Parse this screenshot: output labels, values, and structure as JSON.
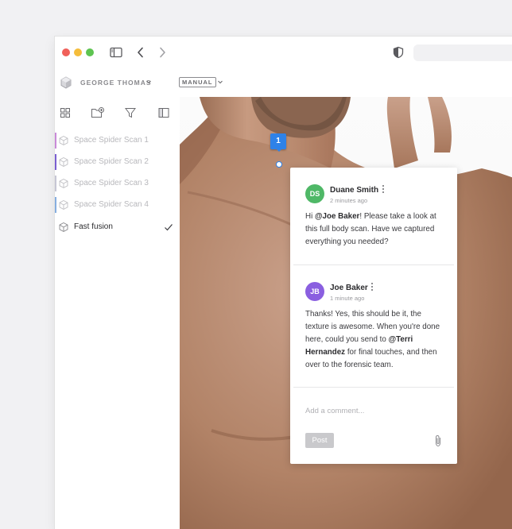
{
  "window": {
    "traffic_lights": [
      "close",
      "minimize",
      "zoom"
    ],
    "toolbar_icons": [
      "sidebar-toggle-icon",
      "back-chevron-icon",
      "forward-chevron-icon",
      "shield-icon"
    ]
  },
  "header": {
    "user_name": "GEORGE THOMAS",
    "mode": "MANUAL"
  },
  "sidebar": {
    "toolbar_icons": [
      "grid-icon",
      "add-folder-icon",
      "filter-icon",
      "panel-icon"
    ],
    "items": [
      {
        "label": "Space Spider Scan 1",
        "color": "#c98ad9",
        "active": false
      },
      {
        "label": "Space Spider Scan 2",
        "color": "#7a5fd1",
        "active": false
      },
      {
        "label": "Space Spider Scan 3",
        "color": "#c6c6d4",
        "active": false
      },
      {
        "label": "Space Spider Scan 4",
        "color": "#86aee0",
        "active": false
      },
      {
        "label": "Fast fusion",
        "color": "",
        "active": true
      }
    ]
  },
  "marker": {
    "number": "1",
    "color": "#2e82e8"
  },
  "comments": [
    {
      "initials": "DS",
      "avatar_color": "#4fb867",
      "name": "Duane Smith",
      "time": "2 minutes ago",
      "body": {
        "pre": "Hi ",
        "mention": "@Joe Baker",
        "post": "! Please take a look at this full body scan. Have we captured everything you needed?"
      }
    },
    {
      "initials": "JB",
      "avatar_color": "#8a5fe0",
      "name": "Joe Baker",
      "time": "1 minute ago",
      "body": {
        "pre": "Thanks! Yes, this should be it, the texture is awesome. When you're done here, could you send to ",
        "mention": "@Terri Hernandez",
        "post": " for final touches, and then over to the forensic team."
      }
    }
  ],
  "composer": {
    "placeholder": "Add a comment...",
    "post_label": "Post"
  }
}
